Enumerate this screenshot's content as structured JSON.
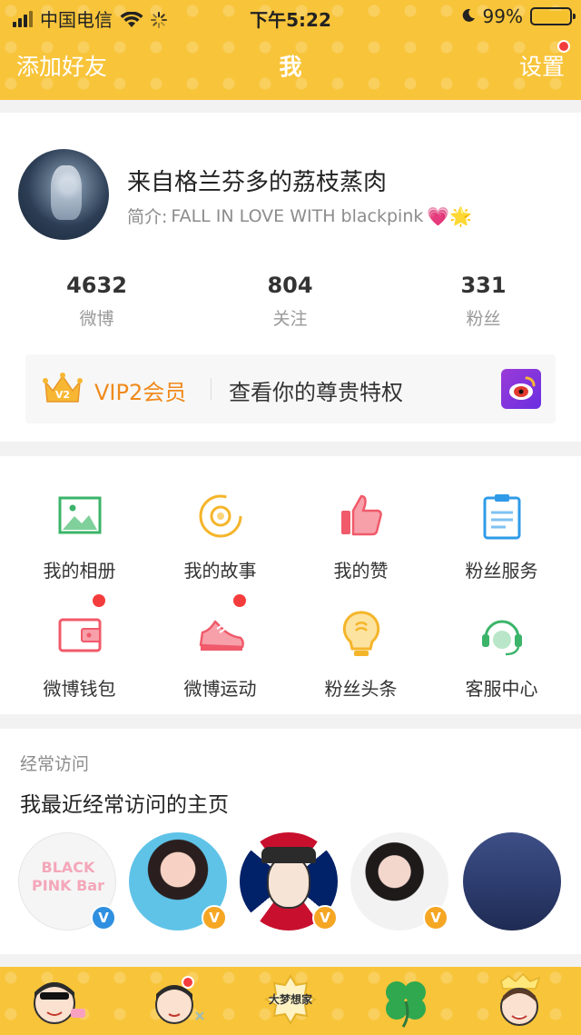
{
  "status_bar": {
    "carrier": "中国电信",
    "time": "下午5:22",
    "battery": "99%",
    "battery_level": 0.99
  },
  "nav": {
    "left_label": "添加好友",
    "title": "我",
    "right_label": "设置"
  },
  "profile": {
    "name": "来自格兰芬多的荔枝蒸肉",
    "intro_prefix": "简介: ",
    "intro_text": "FALL IN LOVE WITH blackpink",
    "intro_emoji": "💗🌟",
    "stats": [
      {
        "value": "4632",
        "label": "微博"
      },
      {
        "value": "804",
        "label": "关注"
      },
      {
        "value": "331",
        "label": "粉丝"
      }
    ],
    "vip": {
      "badge": "V2",
      "label": "VIP2会员",
      "link": "查看你的尊贵特权"
    }
  },
  "services": [
    {
      "label": "我的相册",
      "icon": "photo-album-icon",
      "color": "#3bb46a"
    },
    {
      "label": "我的故事",
      "icon": "story-icon",
      "color": "#f5b52a"
    },
    {
      "label": "我的赞",
      "icon": "thumbs-up-icon",
      "color": "#f05a6a"
    },
    {
      "label": "粉丝服务",
      "icon": "clipboard-icon",
      "color": "#2f9be8"
    },
    {
      "label": "微博钱包",
      "icon": "wallet-icon",
      "color": "#f05a6a"
    },
    {
      "label": "微博运动",
      "icon": "sneaker-icon",
      "color": "#f05a6a"
    },
    {
      "label": "粉丝头条",
      "icon": "lightbulb-icon",
      "color": "#f5b52a"
    },
    {
      "label": "客服中心",
      "icon": "headset-icon",
      "color": "#3bb46a"
    }
  ],
  "recent": {
    "section_title": "经常访问",
    "subtitle": "我最近经常访问的主页",
    "first_avatar_text": "BLACK PINK Bar",
    "avatars": [
      {
        "name": "blackpink-bar-avatar",
        "badge": "V",
        "badge_color": "#2f8fe0"
      },
      {
        "name": "idol-avatar-2",
        "badge": "V",
        "badge_color": "#f5a623"
      },
      {
        "name": "cartoon-avatar-3",
        "badge": "V",
        "badge_color": "#f5a623"
      },
      {
        "name": "idol-avatar-4",
        "badge": "V",
        "badge_color": "#f5a623"
      },
      {
        "name": "ocean-avatar-5",
        "badge": "",
        "badge_color": ""
      }
    ]
  },
  "bottom_bar": {
    "third_tab_text": "大梦想家"
  },
  "colors": {
    "brand_yellow": "#f8c43a",
    "vip_orange": "#f08a1c",
    "notify_red": "#f53c3c"
  }
}
